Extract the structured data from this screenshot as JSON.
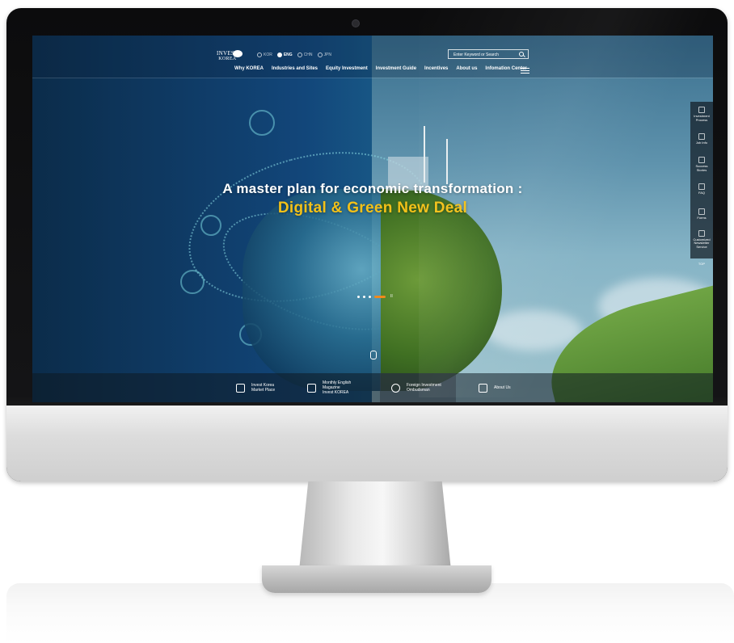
{
  "header": {
    "logo_top": "INVEST",
    "logo_bottom": "KOREA",
    "languages": [
      {
        "label": "KOR",
        "active": false
      },
      {
        "label": "ENG",
        "active": true
      },
      {
        "label": "CHN",
        "active": false
      },
      {
        "label": "JPN",
        "active": false
      }
    ],
    "search_placeholder": "Enter Keyword or Search",
    "nav": [
      "Why KOREA",
      "Industries and Sites",
      "Equity Investment",
      "Investment Guide",
      "Incentives",
      "About us",
      "Infomation Center"
    ]
  },
  "hero": {
    "line1": "A master plan for economic transformation :",
    "line2": "Digital & Green New Deal",
    "line2_color": "#f3c118",
    "pager_active_color": "#f08a1c",
    "pager_pause": "II"
  },
  "quick_menu": {
    "items": [
      {
        "label": "Investment Process",
        "icon": "process-icon"
      },
      {
        "label": "Job Info",
        "icon": "person-icon"
      },
      {
        "label": "Success Stories",
        "icon": "trophy-icon"
      },
      {
        "label": "FAQ",
        "icon": "faq-icon"
      },
      {
        "label": "Forms",
        "icon": "form-icon"
      },
      {
        "label": "Customized Newsletter Service",
        "icon": "newsletter-icon"
      }
    ],
    "top": "TOP"
  },
  "bottom_bar": {
    "items": [
      {
        "line1": "Invest Korea",
        "line2": "Market Place",
        "line3": "",
        "icon": "cube-icon"
      },
      {
        "line1": "Monthly English",
        "line2": "Magazine",
        "line3": "Invest KOREA",
        "icon": "book-icon"
      },
      {
        "line1": "Foreign Investment",
        "line2": "Ombudsman",
        "line3": "",
        "icon": "handshake-icon"
      },
      {
        "line1": "About Us",
        "line2": "",
        "line3": "",
        "icon": "briefcase-icon"
      }
    ]
  }
}
